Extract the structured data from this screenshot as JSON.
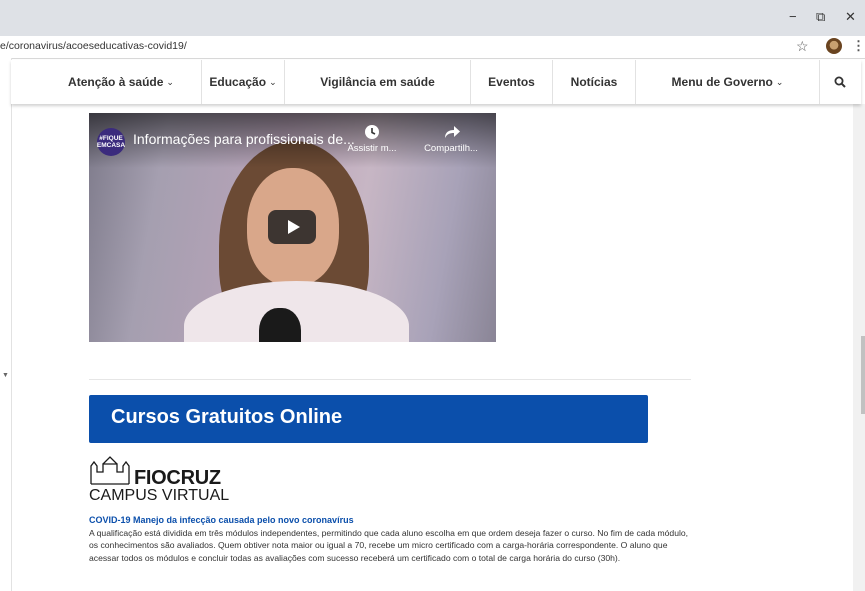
{
  "browser": {
    "url": "e/coronavirus/acoeseducativas-covid19/",
    "window_controls": {
      "minimize": "−",
      "restore": "⧉",
      "close": "✕"
    },
    "star_icon": "☆",
    "menu_icon": "⋮"
  },
  "nav": {
    "items": [
      {
        "label": "Atenção à saúde",
        "dropdown": true
      },
      {
        "label": "Educação",
        "dropdown": true
      },
      {
        "label": "Vigilância em saúde",
        "dropdown": false
      },
      {
        "label": "Eventos",
        "dropdown": false
      },
      {
        "label": "Notícias",
        "dropdown": false
      },
      {
        "label": "Menu de Governo",
        "dropdown": true
      }
    ],
    "chevron": "⌄"
  },
  "video": {
    "logo_text": "#FIQUE EMCASA",
    "title": "Informações para profissionais de...",
    "watch_later_label": "Assistir m...",
    "share_label": "Compartilh..."
  },
  "section": {
    "banner_title": "Cursos Gratuitos Online"
  },
  "fiocruz": {
    "name": "FIOCRUZ",
    "subtitle": "CAMPUS VIRTUAL"
  },
  "course": {
    "title": "COVID-19 Manejo da infecção causada pelo novo coronavírus",
    "description": "A qualificação está dividida em três módulos independentes, permitindo que cada aluno escolha em que ordem deseja fazer o curso. No fim de cada módulo, os conhecimentos são avaliados. Quem obtiver nota maior ou igual a 70, recebe um micro certificado com a carga-horária correspondente. O aluno que acessar todos os módulos e concluir todas as avaliações com sucesso receberá um certificado com o total de carga horária do curso (30h)."
  },
  "colors": {
    "brand_blue": "#0b4fab",
    "titlebar": "#dee1e6"
  }
}
